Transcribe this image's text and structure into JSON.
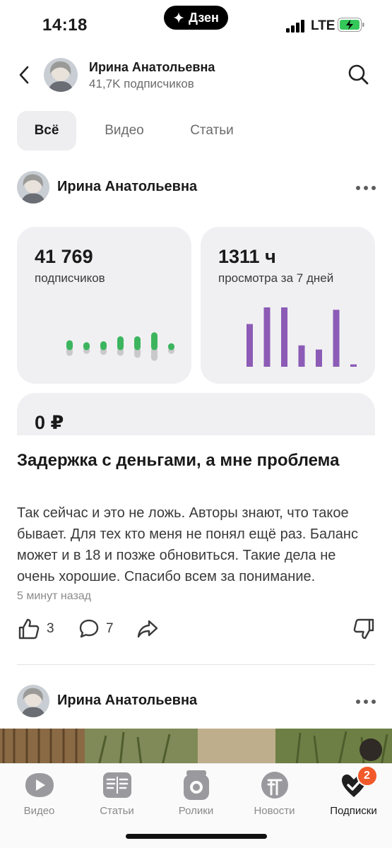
{
  "status_bar": {
    "time": "14:18",
    "dzen_label": "Дзен",
    "network": "LTE"
  },
  "header": {
    "channel_name": "Ирина Анатольевна",
    "subscribers": "41,7K подписчиков"
  },
  "tabs": [
    {
      "label": "Всё",
      "active": true
    },
    {
      "label": "Видео",
      "active": false
    },
    {
      "label": "Статьи",
      "active": false
    }
  ],
  "post1": {
    "author": "Ирина Анатольевна",
    "title": "Задержка с деньгами, а мне проблема",
    "text": "Так сейчас и это не ложь. Авторы знают, что такое бывает. Для тех кто меня не понял ещё раз. Баланс может и в 18 и позже обновиться. Такие дела не очень хорошие.  Спасибо всем за понимание.",
    "time": "5 минут назад",
    "likes": "3",
    "comments": "7"
  },
  "stats": {
    "subscribers": {
      "value": "41 769",
      "label": "подписчиков",
      "color_up": "#3cb55e",
      "color_down": "#c9c9cc",
      "bars": [
        {
          "up": 0.5,
          "down": 0.45
        },
        {
          "up": 0.4,
          "down": 0.35
        },
        {
          "up": 0.45,
          "down": 0.4
        },
        {
          "up": 0.7,
          "down": 0.45
        },
        {
          "up": 0.7,
          "down": 0.55
        },
        {
          "up": 0.9,
          "down": 0.7
        },
        {
          "up": 0.35,
          "down": 0.35
        }
      ]
    },
    "views": {
      "value": "1311 ч",
      "label": "просмотра за 7 дней",
      "color": "#8c5bb6",
      "bars": [
        0.72,
        1.0,
        1.0,
        0.36,
        0.29,
        0.96,
        0.04
      ]
    },
    "earnings": {
      "value": "0 ₽"
    }
  },
  "post2": {
    "author": "Ирина Анатольевна"
  },
  "bottom_nav": [
    {
      "label": "Видео",
      "icon": "video-icon",
      "active": false
    },
    {
      "label": "Статьи",
      "icon": "articles-icon",
      "active": false
    },
    {
      "label": "Ролики",
      "icon": "shorts-icon",
      "active": false
    },
    {
      "label": "Новости",
      "icon": "news-icon",
      "active": false
    },
    {
      "label": "Подписки",
      "icon": "subscriptions-icon",
      "active": true,
      "badge": "2"
    }
  ]
}
